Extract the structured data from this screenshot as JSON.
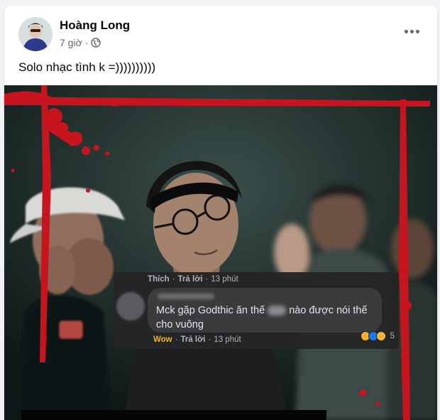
{
  "post": {
    "author": "Hoàng Long",
    "time": "7 giờ",
    "separator": "·",
    "privacy_icon": "globe-icon",
    "more_icon": "more-options-icon",
    "text": "Solo nhạc tình k =))))))))))"
  },
  "comment": {
    "top_actions": {
      "reaction": "Thích",
      "dot1": "·",
      "reply": "Trả lời",
      "dot2": "·",
      "time": "13 phút"
    },
    "text_before": "Mck gặp Godthic ăn thế ",
    "text_after": " nào được nói thế cho vuông",
    "bottom_actions": {
      "reaction": "Wow",
      "dot1": "·",
      "reply": "Trả lời",
      "dot2": "·",
      "time": "13 phút"
    },
    "reaction_count": "5",
    "reaction_icons": [
      "haha-icon",
      "like-icon",
      "wow-icon"
    ]
  },
  "colors": {
    "blood_red": "#c8141e",
    "wow_label": "#f7b125",
    "comment_bg": "#242526",
    "bubble_bg": "#3a3b3c"
  }
}
